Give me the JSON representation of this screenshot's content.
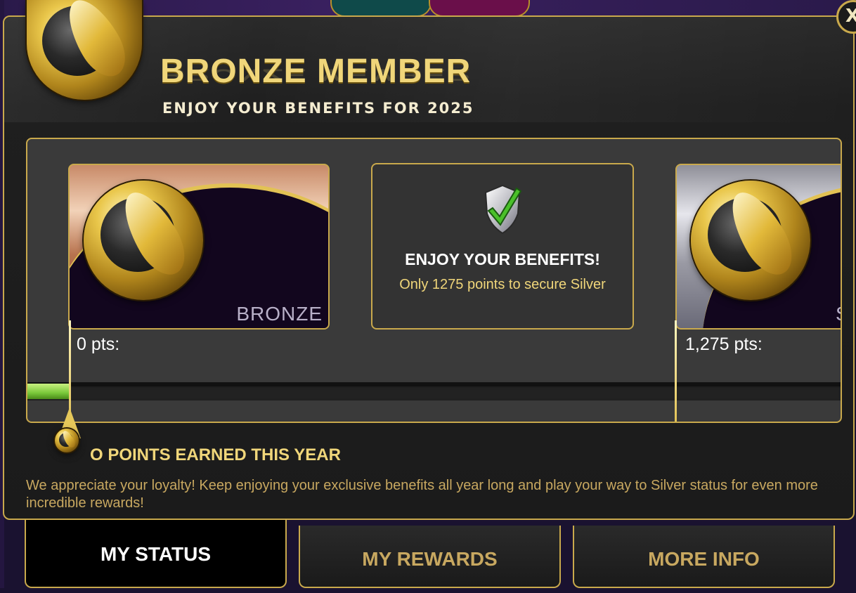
{
  "dialog": {
    "title": "BRONZE MEMBER",
    "subtitle": "ENJOY YOUR BENEFITS FOR 2025",
    "close_label": "X"
  },
  "tiers": [
    {
      "label": "BRONZE",
      "points": "0 pts:"
    },
    {
      "label": "S",
      "points": "1,275 pts:"
    }
  ],
  "benefit": {
    "title": "ENJOY YOUR BENEFITS!",
    "description": "Only 1275 points to secure Silver"
  },
  "progress": {
    "fraction": 0.0,
    "earned_text": "O POINTS EARNED THIS YEAR"
  },
  "message": "We appreciate your loyalty! Keep enjoying your exclusive benefits all year long and play your way to Silver status for even more incredible rewards!",
  "tabs": [
    {
      "label": "MY STATUS",
      "active": true
    },
    {
      "label": "MY REWARDS",
      "active": false
    },
    {
      "label": "MORE INFO",
      "active": false
    }
  ],
  "colors": {
    "gold": "#c9a94c",
    "title_gold": "#f0d67a",
    "progress_green": "#7ac83a"
  }
}
